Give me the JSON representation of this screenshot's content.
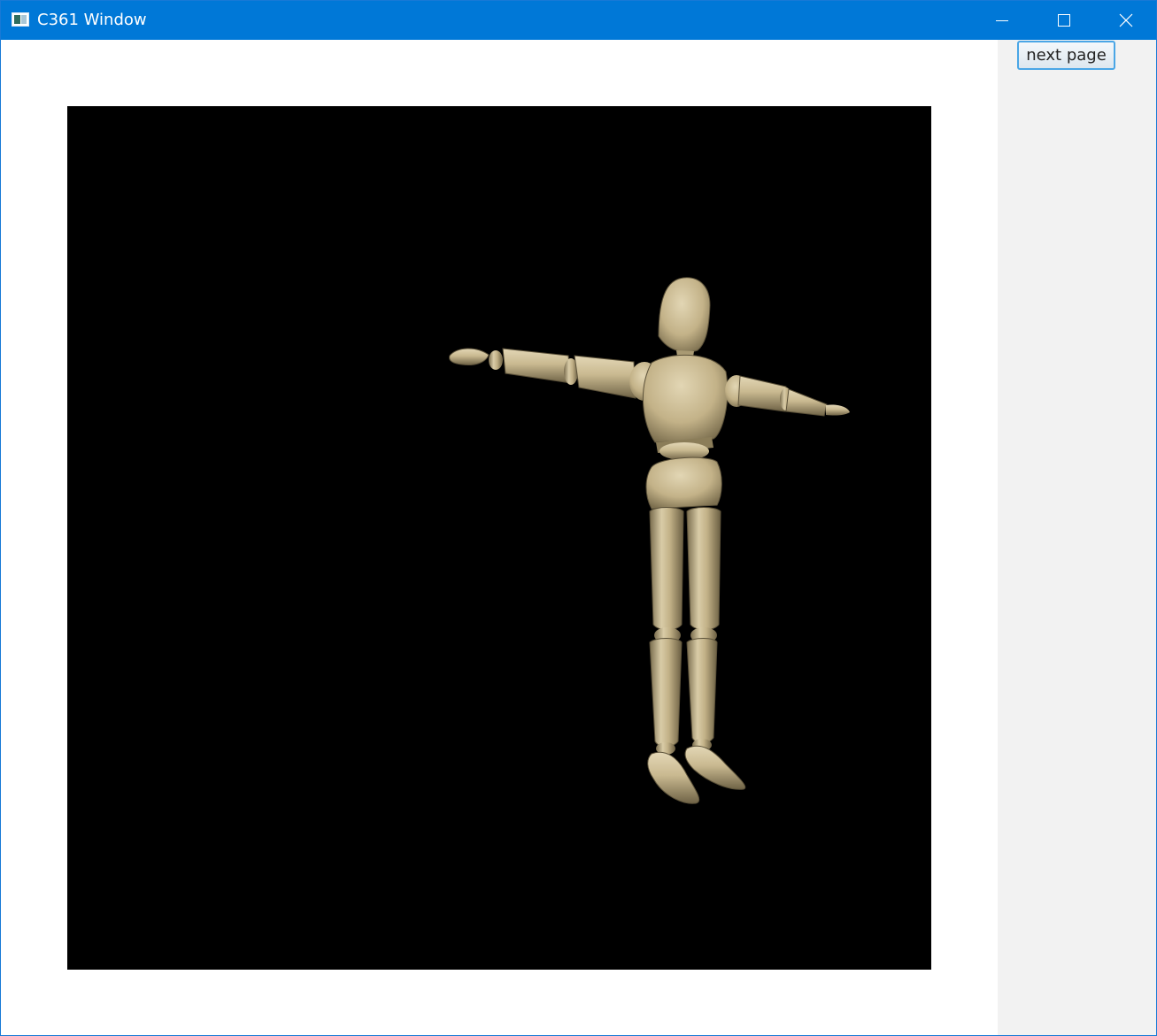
{
  "window": {
    "title": "C361 Window",
    "icon": "app-window-icon",
    "controls": {
      "minimize_icon": "minimize-icon",
      "maximize_icon": "maximize-icon",
      "close_icon": "close-icon"
    }
  },
  "viewport": {
    "background": "#000000",
    "subject": "wooden-mannequin-t-pose",
    "figure_color": "#c4b48d"
  },
  "side_panel": {
    "next_page_label": "next page"
  },
  "colors": {
    "titlebar": "#0078d7",
    "side_panel": "#f2f2f2",
    "button_border": "#4aa6e6"
  }
}
